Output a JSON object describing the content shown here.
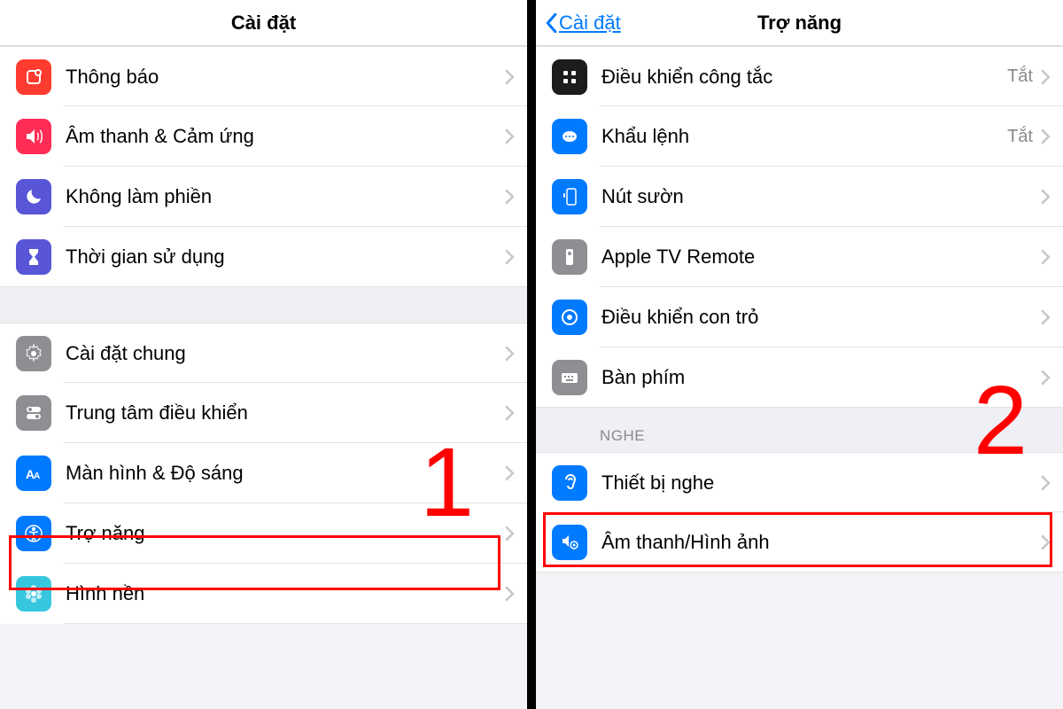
{
  "left": {
    "title": "Cài đặt",
    "groups": [
      {
        "header": null,
        "items": [
          {
            "id": "notifications",
            "label": "Thông báo",
            "icon": "notification-icon",
            "color": "#ff3b30"
          },
          {
            "id": "sounds",
            "label": "Âm thanh & Cảm ứng",
            "icon": "speaker-icon",
            "color": "#ff2d55"
          },
          {
            "id": "dnd",
            "label": "Không làm phiền",
            "icon": "moon-icon",
            "color": "#5856d6"
          },
          {
            "id": "screentime",
            "label": "Thời gian sử dụng",
            "icon": "hourglass-icon",
            "color": "#5856d6"
          }
        ]
      },
      {
        "header": null,
        "items": [
          {
            "id": "general",
            "label": "Cài đặt chung",
            "icon": "gear-icon",
            "color": "#8e8e93"
          },
          {
            "id": "controlcenter",
            "label": "Trung tâm điều khiển",
            "icon": "switches-icon",
            "color": "#8e8e93"
          },
          {
            "id": "display",
            "label": "Màn hình & Độ sáng",
            "icon": "text-size-icon",
            "color": "#007aff"
          },
          {
            "id": "accessibility",
            "label": "Trợ năng",
            "icon": "accessibility-icon",
            "color": "#007aff",
            "highlighted": true
          },
          {
            "id": "wallpaper",
            "label": "Hình nền",
            "icon": "flower-icon",
            "color": "#36c7de"
          }
        ]
      }
    ],
    "step_annotation": "1"
  },
  "right": {
    "title": "Trợ năng",
    "back_label": "Cài đặt",
    "groups": [
      {
        "header": null,
        "items": [
          {
            "id": "switchcontrol",
            "label": "Điều khiển công tắc",
            "value": "Tắt",
            "icon": "grid-icon",
            "color": "#1c1c1e"
          },
          {
            "id": "voicecontrol",
            "label": "Khẩu lệnh",
            "value": "Tắt",
            "icon": "voice-icon",
            "color": "#007aff"
          },
          {
            "id": "sidebutton",
            "label": "Nút sườn",
            "icon": "side-button-icon",
            "color": "#007aff"
          },
          {
            "id": "appletv",
            "label": "Apple TV Remote",
            "icon": "remote-icon",
            "color": "#8e8e93"
          },
          {
            "id": "pointer",
            "label": "Điều khiển con trỏ",
            "icon": "pointer-icon",
            "color": "#007aff"
          },
          {
            "id": "keyboards",
            "label": "Bàn phím",
            "icon": "keyboard-icon",
            "color": "#8e8e93"
          }
        ]
      },
      {
        "header": "NGHE",
        "items": [
          {
            "id": "hearing",
            "label": "Thiết bị nghe",
            "icon": "ear-icon",
            "color": "#007aff"
          },
          {
            "id": "audiovisual",
            "label": "Âm thanh/Hình ảnh",
            "icon": "audio-visual-icon",
            "color": "#007aff",
            "highlighted": true
          }
        ]
      }
    ],
    "step_annotation": "2"
  }
}
